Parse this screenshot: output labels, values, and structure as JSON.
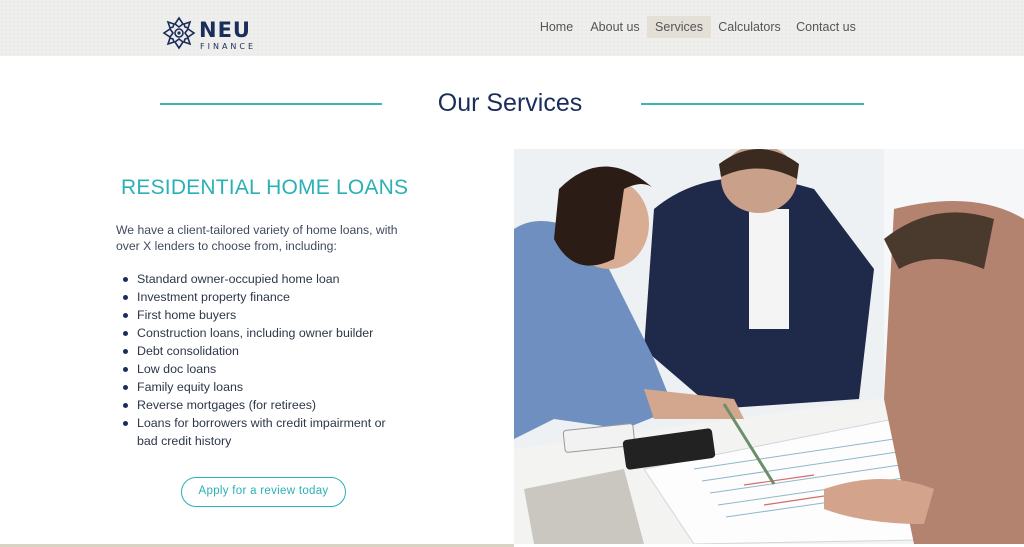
{
  "brand": {
    "name": "NEU",
    "sub": "FINANCE"
  },
  "nav": {
    "items": [
      {
        "label": "Home"
      },
      {
        "label": "About us"
      },
      {
        "label": "Services"
      },
      {
        "label": "Calculators"
      },
      {
        "label": "Contact us"
      }
    ],
    "active": "Services"
  },
  "section": {
    "title": "Our Services"
  },
  "loans": {
    "title": "RESIDENTIAL HOME LOANS",
    "intro": "We have a client-tailored variety of home loans, with over X lenders to choose from, including:",
    "items": [
      "Standard owner-occupied home loan",
      "Investment property finance",
      "First home buyers",
      "Construction loans, including owner builder",
      "Debt consolidation",
      "Low doc loans",
      "Family equity loans",
      "Reverse mortgages (for retirees)",
      "Loans for borrowers with credit impairment or bad credit history"
    ],
    "cta_label": "Apply for a review today"
  },
  "colors": {
    "navy": "#1b2d5b",
    "teal": "#2ab1b5",
    "nav_active_bg": "#e4e0d7"
  }
}
